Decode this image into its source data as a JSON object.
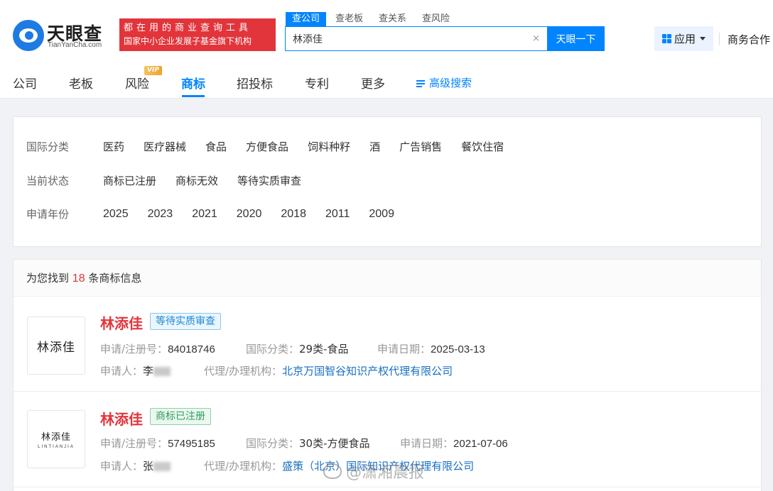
{
  "header": {
    "logo_text": "天眼查",
    "logo_domain": "TianYanCha.com",
    "slogan_line1": "都在用的商业查询工具",
    "slogan_line2": "国家中小企业发展子基金旗下机构",
    "search_tabs": [
      "查公司",
      "查老板",
      "查关系",
      "查风险"
    ],
    "search_value": "林添佳",
    "clear_glyph": "×",
    "search_button": "天眼一下",
    "app_button": "应用",
    "business": "商务合作"
  },
  "nav": {
    "items": [
      "公司",
      "老板",
      "风险",
      "商标",
      "招投标",
      "专利",
      "更多"
    ],
    "active": "商标",
    "vip_badge": "VIP",
    "advanced_search": "高级搜索"
  },
  "filters": [
    {
      "label": "国际分类",
      "options": [
        "医药",
        "医疗器械",
        "食品",
        "方便食品",
        "饲料种籽",
        "酒",
        "广告销售",
        "餐饮住宿"
      ]
    },
    {
      "label": "当前状态",
      "options": [
        "商标已注册",
        "商标无效",
        "等待实质审查"
      ]
    },
    {
      "label": "申请年份",
      "options": [
        "2025",
        "2023",
        "2021",
        "2020",
        "2018",
        "2011",
        "2009"
      ]
    }
  ],
  "results": {
    "prefix": "为您找到",
    "count": "18",
    "suffix": "条商标信息",
    "labels": {
      "reg_no": "申请/注册号：",
      "class": "国际分类：",
      "date": "申请日期：",
      "applicant": "申请人：",
      "agency": "代理/办理机构："
    },
    "items": [
      {
        "thumb_text": "林添佳",
        "thumb_sub": "",
        "name": "林添佳",
        "status": "等待实质审查",
        "reg_no": "84018746",
        "class": "29类-食品",
        "date": "2025-03-13",
        "applicant": "李",
        "agency": "北京万国智谷知识产权代理有限公司"
      },
      {
        "thumb_text": "林添佳",
        "thumb_sub": "LINTIANJIA",
        "name": "林添佳",
        "status": "商标已注册",
        "reg_no": "57495185",
        "class": "30类-方便食品",
        "date": "2021-07-06",
        "applicant": "张",
        "agency": "盛策（北京）国际知识产权代理有限公司"
      }
    ]
  },
  "watermark": "@潇湘晨报",
  "colors": {
    "brand_blue": "#0084ff",
    "brand_red": "#e1353b",
    "link": "#1a6fc4"
  },
  "icons": [
    "tianyancha-logo-icon",
    "clear-icon",
    "apps-grid-icon",
    "caret-down-icon",
    "filter-icon",
    "weibo-icon"
  ]
}
